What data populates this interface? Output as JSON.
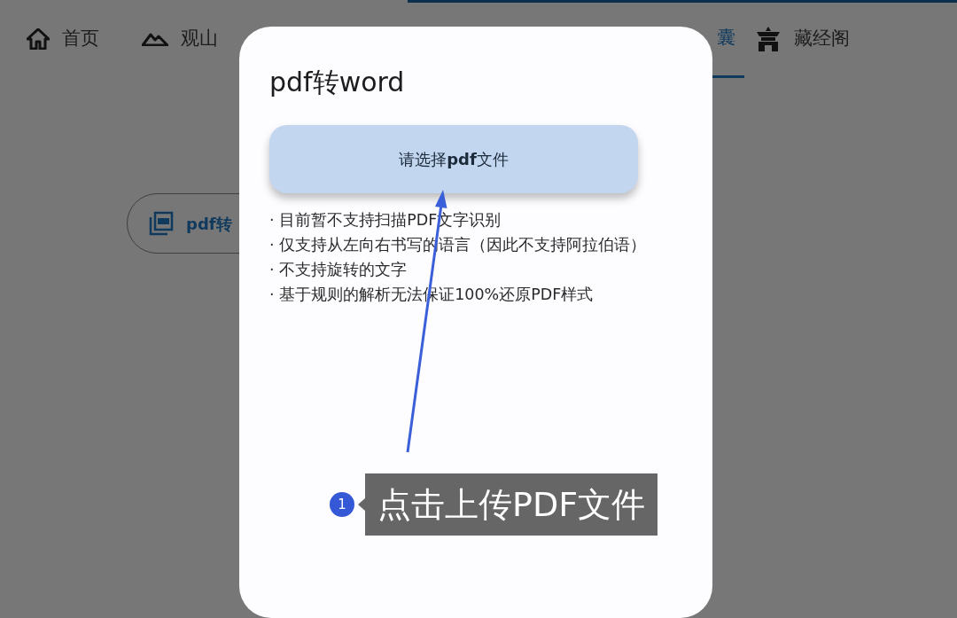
{
  "nav": {
    "items": [
      {
        "label": "首页",
        "selected": false
      },
      {
        "label": "观山",
        "selected": false
      },
      {
        "label": "囊",
        "selected": true
      },
      {
        "label": "藏经阁",
        "selected": false
      }
    ]
  },
  "chip": {
    "label": "pdf转"
  },
  "dialog": {
    "title": "pdf转word",
    "button": "请选择**pdf**文件",
    "notes": [
      "· 目前暂不支持扫描PDF文字识别",
      "· 仅支持从左向右书写的语言（因此不支持阿拉伯语）",
      "· 不支持旋转的文字",
      "· 基于规则的解析无法保证100%还原PDF样式"
    ]
  },
  "annotation": {
    "number": "1",
    "text": "点击上传PDF文件"
  }
}
